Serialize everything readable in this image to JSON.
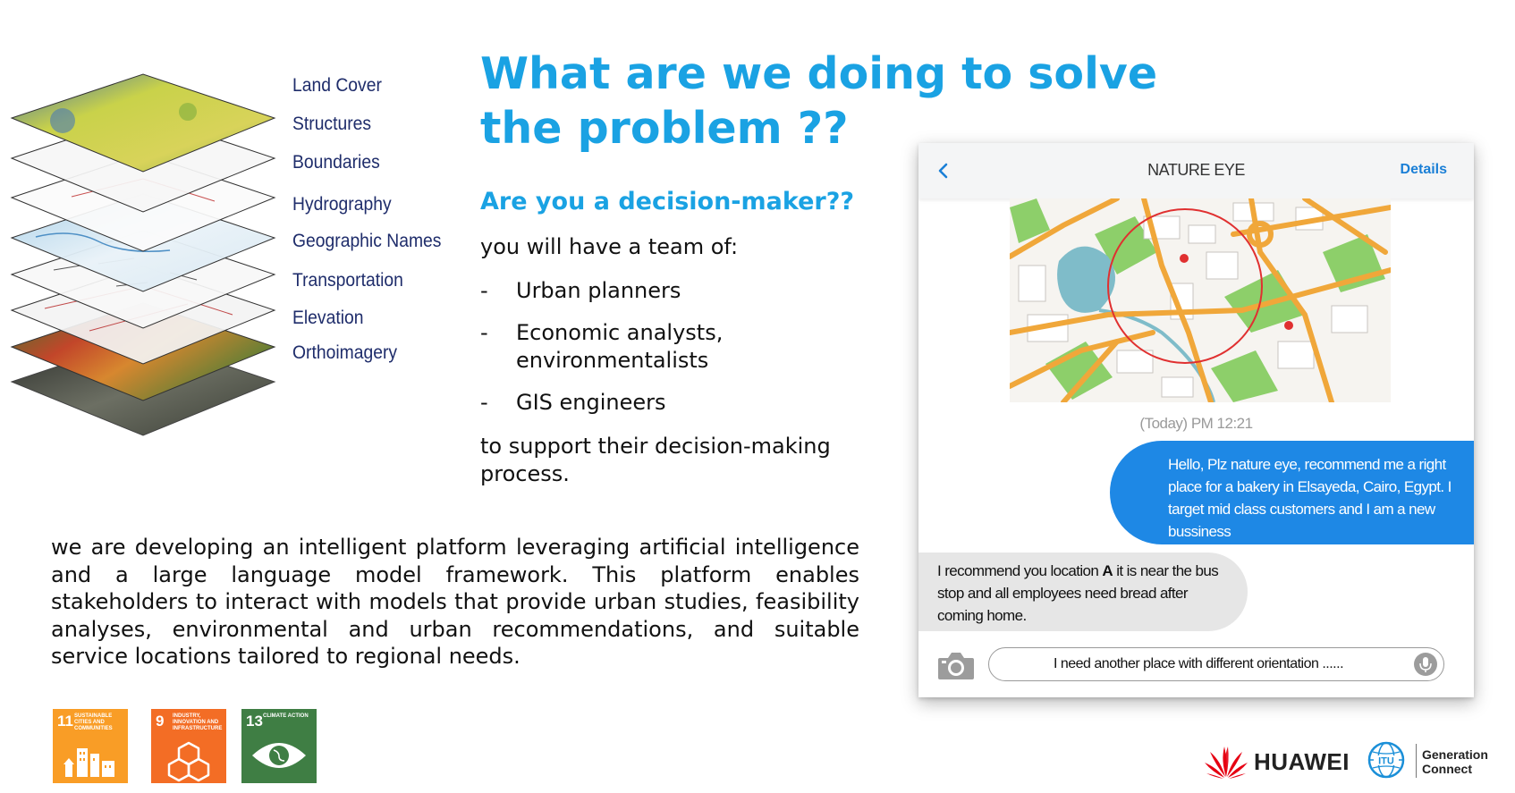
{
  "layers": [
    {
      "label": "Land Cover"
    },
    {
      "label": "Structures"
    },
    {
      "label": "Boundaries"
    },
    {
      "label": "Hydrography"
    },
    {
      "label": "Geographic Names"
    },
    {
      "label": "Transportation"
    },
    {
      "label": "Elevation"
    },
    {
      "label": "Orthoimagery"
    }
  ],
  "title": "What are we doing to solve the problem ??",
  "subtitle": "Are you a decision-maker??",
  "team_intro": "you will have a team of:",
  "team": [
    {
      "dash": "-",
      "text": "Urban planners"
    },
    {
      "dash": "-",
      "text": " Economic analysts, environmentalists"
    },
    {
      "dash": "-",
      "text": "GIS engineers"
    }
  ],
  "support_text": " to support their decision-making process.",
  "platform_text": "we are developing an intelligent platform leveraging artificial intelligence and a large language model framework. This platform enables stakeholders to interact with models that provide urban studies, feasibility analyses, environmental and urban recommendations, and suitable service locations tailored to regional needs.",
  "sdgs": [
    {
      "number": "11",
      "text": "Sustainable cities and communities",
      "color": "#f99d26"
    },
    {
      "number": "9",
      "text": "Industry, innovation and infrastructure",
      "color": "#f36d25"
    },
    {
      "number": "13",
      "text": "Climate action",
      "color": "#3f7e44"
    }
  ],
  "chat": {
    "app_title": "NATURE EYE",
    "details_label": "Details",
    "timestamp": "(Today) PM 12:21",
    "user_message": "Hello, Plz nature eye, recommend me a right place for a bakery in Elsayeda, Cairo, Egypt. I target mid class customers and I am a new bussiness",
    "bot_message_pre": "I recommend you location ",
    "bot_message_bold": "A",
    "bot_message_post": " it is near the bus stop and all employees need bread after coming home.",
    "input_value": "I need another place with different orientation ......",
    "accent_color": "#1e88e5"
  },
  "logos": {
    "huawei": "HUAWEI",
    "itu": "ITU",
    "generation_line1": "Generation",
    "generation_line2": "Connect"
  }
}
